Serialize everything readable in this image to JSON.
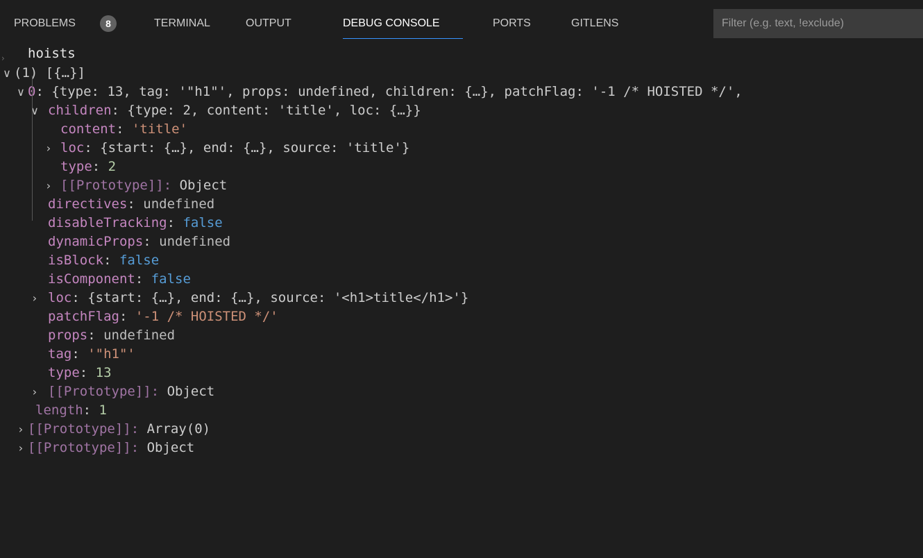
{
  "tabs": [
    {
      "label": "PROBLEMS",
      "badge": "8",
      "active": false
    },
    {
      "label": "TERMINAL",
      "active": false
    },
    {
      "label": "OUTPUT",
      "active": false
    },
    {
      "label": "DEBUG CONSOLE",
      "active": true
    },
    {
      "label": "PORTS",
      "active": false
    },
    {
      "label": "GITLENS",
      "active": false
    }
  ],
  "filter": {
    "placeholder": "Filter (e.g. text, !exclude)",
    "value": ""
  },
  "console": {
    "expression": "hoists",
    "array_summary": "(1) [{…}]",
    "item0": {
      "key": "0",
      "summary_type_key": "type",
      "summary_type_val": "13",
      "summary_tag_key": "tag",
      "summary_tag_val": "'\"h1\"'",
      "summary_props_key": "props",
      "summary_props_val": "undefined",
      "summary_children_key": "children",
      "summary_children_val": "{…}",
      "summary_patch_key": "patchFlag",
      "summary_patch_val": "'-1 /* HOISTED */'"
    },
    "children": {
      "key": "children",
      "summary": "{type: 2, content: 'title', loc: {…}}",
      "content_key": "content",
      "content_val": "'title'",
      "loc_key": "loc",
      "loc_val": "{start: {…}, end: {…}, source: 'title'}",
      "type_key": "type",
      "type_val": "2",
      "proto_key": "[[Prototype]]",
      "proto_val": "Object"
    },
    "props": [
      {
        "key": "directives",
        "val": "undefined",
        "kind": "u"
      },
      {
        "key": "disableTracking",
        "val": "false",
        "kind": "b"
      },
      {
        "key": "dynamicProps",
        "val": "undefined",
        "kind": "u"
      },
      {
        "key": "isBlock",
        "val": "false",
        "kind": "b"
      },
      {
        "key": "isComponent",
        "val": "false",
        "kind": "b"
      }
    ],
    "loc": {
      "key": "loc",
      "val": "{start: {…}, end: {…}, source: '<h1>title</h1>'}"
    },
    "patchFlag": {
      "key": "patchFlag",
      "val": "'-1 /* HOISTED */'"
    },
    "propsUndef": {
      "key": "props",
      "val": "undefined"
    },
    "tag": {
      "key": "tag",
      "val": "'\"h1\"'"
    },
    "type": {
      "key": "type",
      "val": "13"
    },
    "objProto": {
      "key": "[[Prototype]]",
      "val": "Object"
    },
    "length": {
      "key": "length",
      "val": "1"
    },
    "arrProto": {
      "key": "[[Prototype]]",
      "val": "Array(0)"
    },
    "outerProto": {
      "key": "[[Prototype]]",
      "val": "Object"
    }
  }
}
